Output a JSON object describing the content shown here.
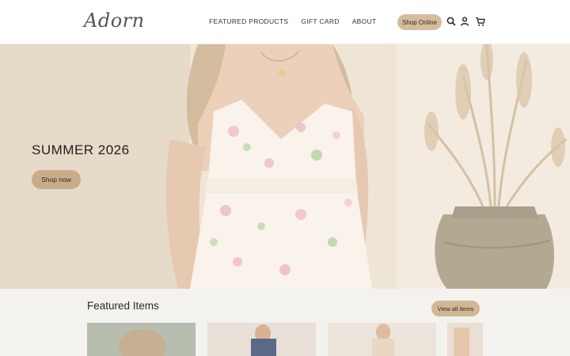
{
  "header": {
    "logo_text": "Adorn",
    "nav": [
      {
        "label": "FEATURED PRODUCTS"
      },
      {
        "label": "GIFT CARD"
      },
      {
        "label": "ABOUT"
      }
    ],
    "shop_online_label": "Shop Online",
    "icons": [
      "search-icon",
      "user-icon",
      "cart-icon"
    ]
  },
  "hero": {
    "title": "SUMMER 2026",
    "button_label": "Shop now"
  },
  "featured": {
    "title": "Featured Items",
    "view_all_label": "View all items"
  },
  "colors": {
    "accent": "#d6bc9c",
    "hero_bg": "#e8dcc8",
    "featured_bg": "#f3f2ef"
  }
}
